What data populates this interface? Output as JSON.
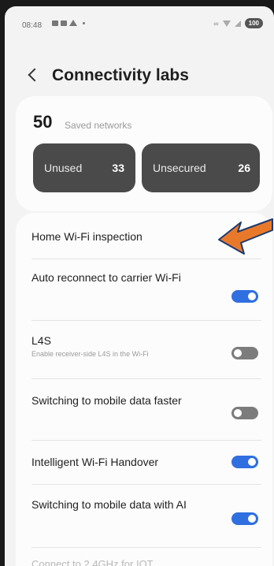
{
  "status_bar": {
    "time": "08:48",
    "link_glyph": "∞",
    "battery": "100"
  },
  "header": {
    "title": "Connectivity labs",
    "back_icon": "chevron-left-icon"
  },
  "saved_networks": {
    "count": "50",
    "label": "Saved networks",
    "unused_label": "Unused",
    "unused_value": "33",
    "unsecured_label": "Unsecured",
    "unsecured_value": "26"
  },
  "settings": {
    "home_wifi_inspection": "Home Wi-Fi inspection",
    "auto_reconnect": {
      "title": "Auto reconnect to carrier Wi-Fi",
      "enabled": true
    },
    "l4s": {
      "title": "L4S",
      "subtitle": "Enable receiver-side L4S in the Wi-Fi",
      "enabled": false
    },
    "switch_faster": {
      "title": "Switching to mobile data faster",
      "enabled": false
    },
    "intelligent_handover": {
      "title": "Intelligent Wi-Fi Handover",
      "enabled": true
    },
    "switch_ai": {
      "title": "Switching to mobile data with AI",
      "enabled": true
    },
    "cutoff_row": "Connect to 2.4GHz for IOT"
  },
  "colors": {
    "toggle_on": "#2f6fe0",
    "toggle_off": "#7c7c7c",
    "annotation_arrow": "#e8792b"
  }
}
